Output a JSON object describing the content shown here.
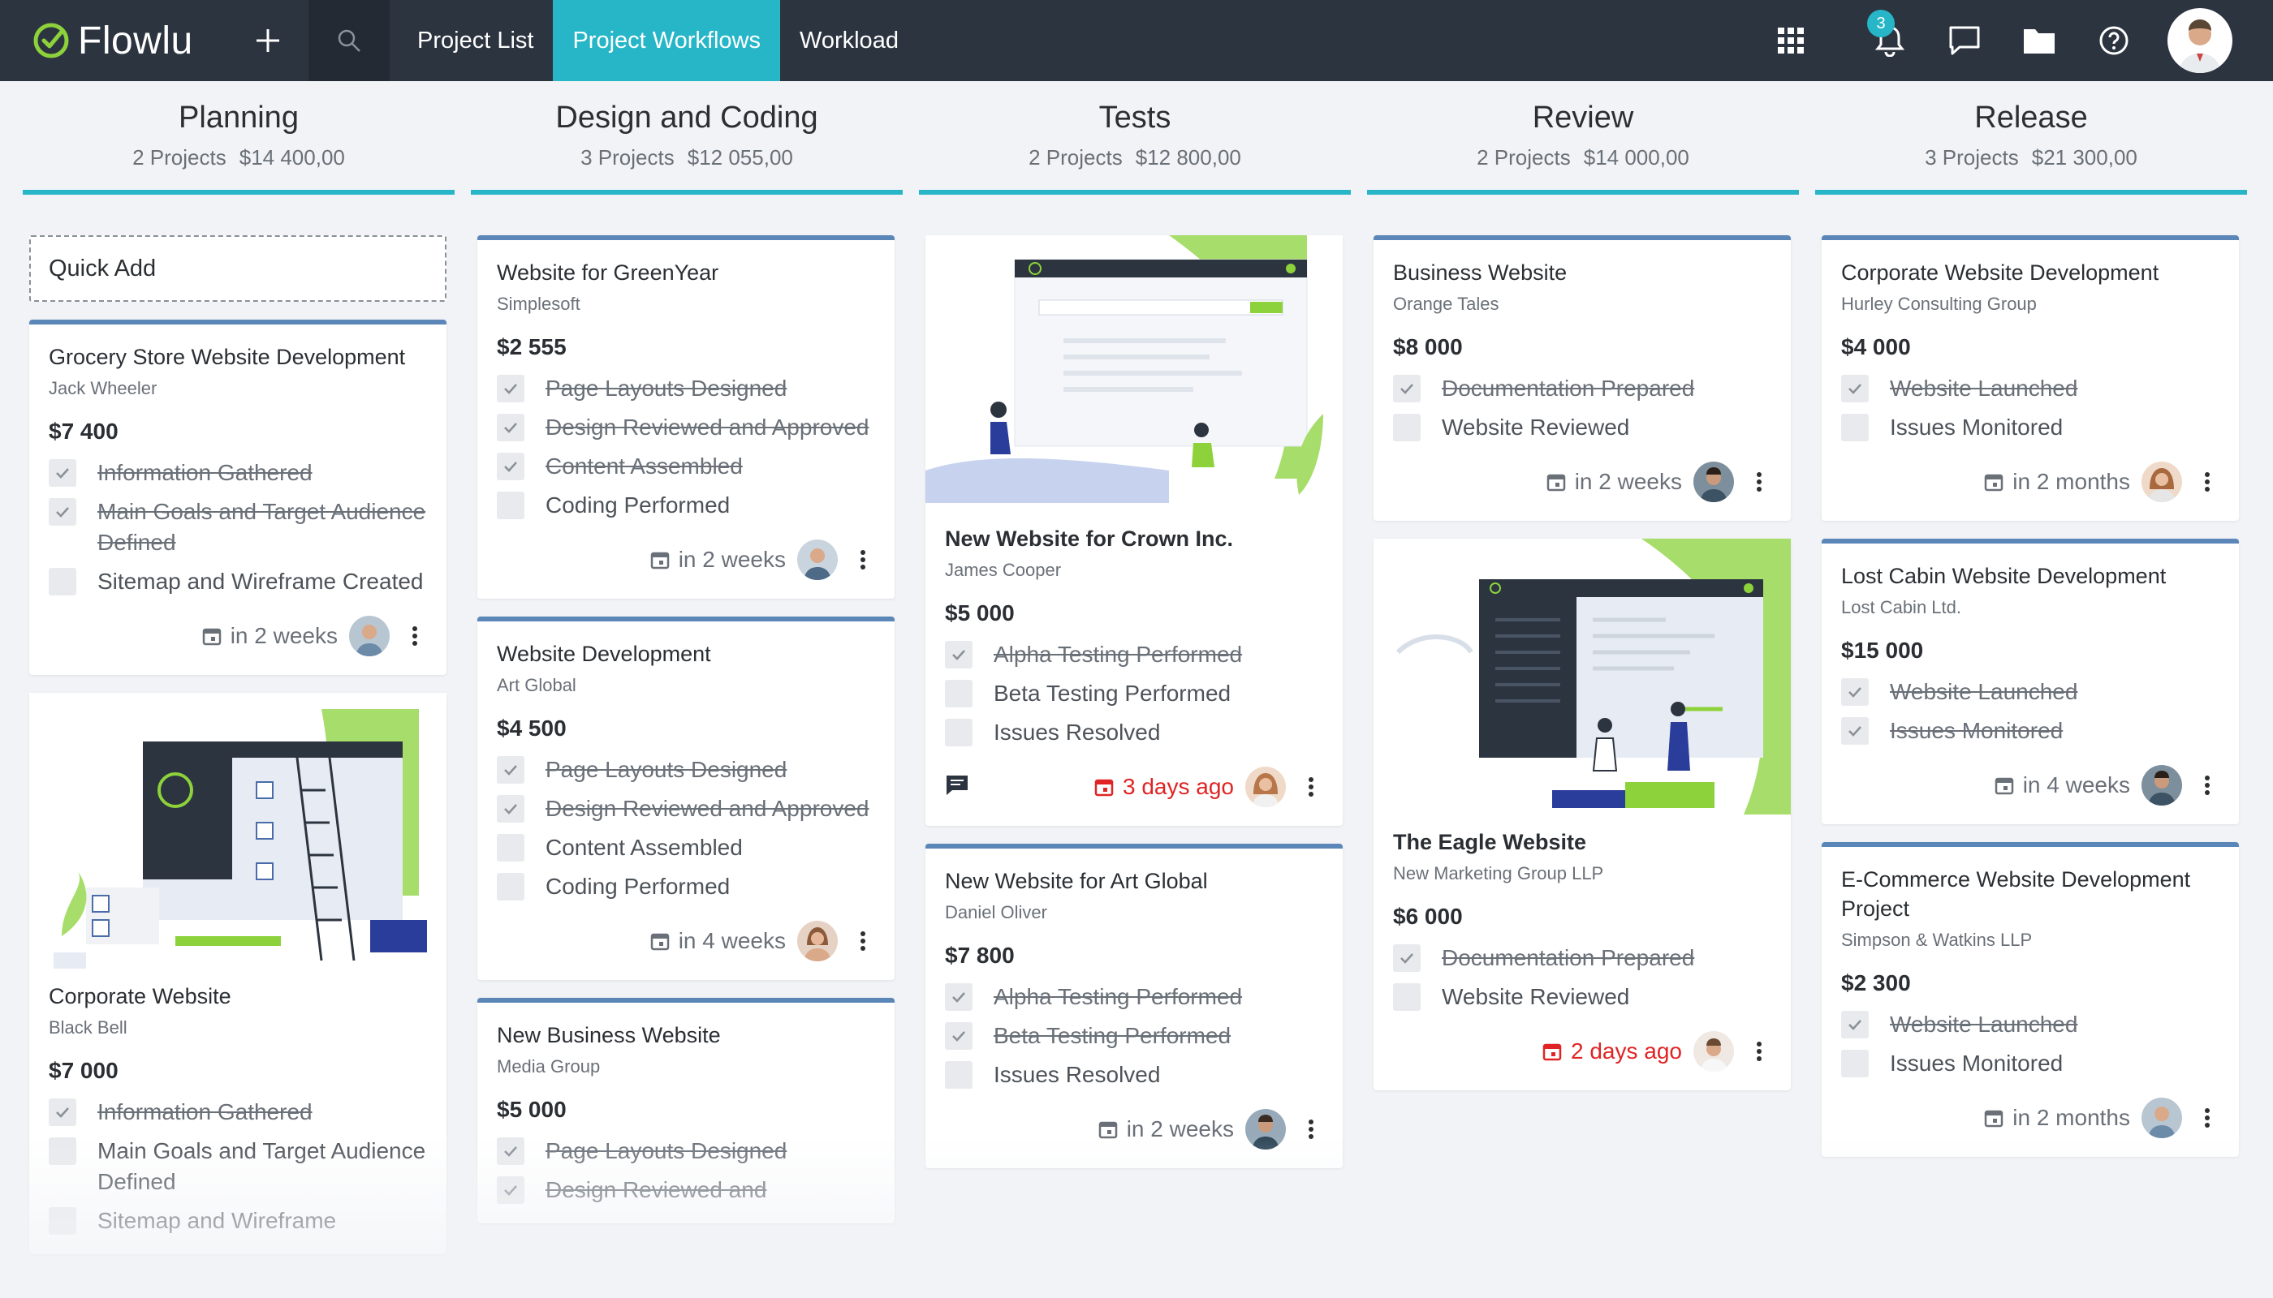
{
  "app": {
    "name": "Flowlu"
  },
  "nav": {
    "tabs": [
      "Project List",
      "Project Workflows",
      "Workload"
    ],
    "active": "Project Workflows"
  },
  "notifications": {
    "count": "3"
  },
  "colors": {
    "accent": "#27b6c8",
    "topbar": "#2c3440",
    "card_border": "#5b86b8",
    "overdue": "#e02424",
    "brand_green": "#8dd23b"
  },
  "quick_add": "Quick Add",
  "columns": [
    {
      "title": "Planning",
      "projects": "2 Projects",
      "amount": "$14 400,00",
      "cards": [
        {
          "title": "Grocery Store Website Development",
          "client": "Jack Wheeler",
          "amount": "$7 400",
          "tasks": [
            {
              "label": "Information Gathered",
              "done": true
            },
            {
              "label": "Main Goals and Target Audience Defined",
              "done": true
            },
            {
              "label": "Sitemap and Wireframe Created",
              "done": false
            }
          ],
          "due": "in 2 weeks"
        },
        {
          "title": "Corporate Website",
          "client": "Black Bell",
          "amount": "$7 000",
          "tasks": [
            {
              "label": "Information Gathered",
              "done": true
            },
            {
              "label": "Main Goals and Target Audience Defined",
              "done": false
            },
            {
              "label": "Sitemap and Wireframe",
              "done": false
            }
          ]
        }
      ]
    },
    {
      "title": "Design and Coding",
      "projects": "3 Projects",
      "amount": "$12 055,00",
      "cards": [
        {
          "title": "Website for GreenYear",
          "client": "Simplesoft",
          "amount": "$2 555",
          "tasks": [
            {
              "label": "Page Layouts Designed",
              "done": true
            },
            {
              "label": "Design Reviewed and Approved",
              "done": true
            },
            {
              "label": "Content Assembled",
              "done": true
            },
            {
              "label": "Coding Performed",
              "done": false
            }
          ],
          "due": "in 2 weeks"
        },
        {
          "title": "Website Development",
          "client": "Art Global",
          "amount": "$4 500",
          "tasks": [
            {
              "label": "Page Layouts Designed",
              "done": true
            },
            {
              "label": "Design Reviewed and Approved",
              "done": true
            },
            {
              "label": "Content Assembled",
              "done": false
            },
            {
              "label": "Coding Performed",
              "done": false
            }
          ],
          "due": "in 4 weeks"
        },
        {
          "title": "New Business Website",
          "client": "Media Group",
          "amount": "$5 000",
          "tasks": [
            {
              "label": "Page Layouts Designed",
              "done": true
            },
            {
              "label": "Design Reviewed and",
              "done": true
            }
          ]
        }
      ]
    },
    {
      "title": "Tests",
      "projects": "2 Projects",
      "amount": "$12 800,00",
      "cards": [
        {
          "title": "New Website for Crown Inc.",
          "client": "James Cooper",
          "amount": "$5 000",
          "tasks": [
            {
              "label": "Alpha Testing Performed",
              "done": true
            },
            {
              "label": "Beta Testing Performed",
              "done": false
            },
            {
              "label": "Issues Resolved",
              "done": false
            }
          ],
          "due": "3 days ago"
        },
        {
          "title": "New Website for Art Global",
          "client": "Daniel Oliver",
          "amount": "$7 800",
          "tasks": [
            {
              "label": "Alpha Testing Performed",
              "done": true
            },
            {
              "label": "Beta Testing Performed",
              "done": true
            },
            {
              "label": "Issues Resolved",
              "done": false
            }
          ],
          "due": "in 2 weeks"
        }
      ]
    },
    {
      "title": "Review",
      "projects": "2 Projects",
      "amount": "$14 000,00",
      "cards": [
        {
          "title": "Business Website",
          "client": "Orange Tales",
          "amount": "$8 000",
          "tasks": [
            {
              "label": "Documentation Prepared",
              "done": true
            },
            {
              "label": "Website Reviewed",
              "done": false
            }
          ],
          "due": "in 2 weeks"
        },
        {
          "title": "The Eagle Website",
          "client": "New Marketing Group LLP",
          "amount": "$6 000",
          "tasks": [
            {
              "label": "Documentation Prepared",
              "done": true
            },
            {
              "label": "Website Reviewed",
              "done": false
            }
          ],
          "due": "2 days ago"
        }
      ]
    },
    {
      "title": "Release",
      "projects": "3 Projects",
      "amount": "$21 300,00",
      "cards": [
        {
          "title": "Corporate Website Development",
          "client": "Hurley Consulting Group",
          "amount": "$4 000",
          "tasks": [
            {
              "label": "Website Launched",
              "done": true
            },
            {
              "label": "Issues Monitored",
              "done": false
            }
          ],
          "due": "in 2 months"
        },
        {
          "title": "Lost Cabin Website Development",
          "client": "Lost Cabin Ltd.",
          "amount": "$15 000",
          "tasks": [
            {
              "label": "Website Launched",
              "done": true
            },
            {
              "label": "Issues Monitored",
              "done": true
            }
          ],
          "due": "in 4 weeks"
        },
        {
          "title": "E-Commerce Website Development Project",
          "client": "Simpson & Watkins LLP",
          "amount": "$2 300",
          "tasks": [
            {
              "label": "Website Launched",
              "done": true
            },
            {
              "label": "Issues Monitored",
              "done": false
            }
          ],
          "due": "in 2 months"
        }
      ]
    }
  ]
}
